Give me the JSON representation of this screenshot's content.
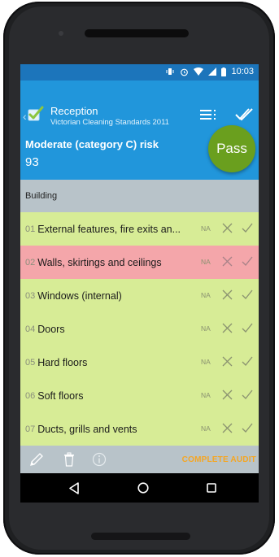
{
  "status_bar": {
    "time": "10:03"
  },
  "app_bar": {
    "title": "Reception",
    "subtitle": "Victorian Cleaning Standards 2011",
    "risk_label": "Moderate (category C) risk",
    "risk_score": "93",
    "result": "Pass"
  },
  "section": {
    "title": "Building"
  },
  "items": [
    {
      "num": "01",
      "label": "External features, fire exits an...",
      "na": "NA",
      "status": "ok"
    },
    {
      "num": "02",
      "label": "Walls, skirtings and ceilings",
      "na": "NA",
      "status": "fail"
    },
    {
      "num": "03",
      "label": "Windows (internal)",
      "na": "NA",
      "status": "ok"
    },
    {
      "num": "04",
      "label": "Doors",
      "na": "NA",
      "status": "ok"
    },
    {
      "num": "05",
      "label": "Hard floors",
      "na": "NA",
      "status": "ok"
    },
    {
      "num": "06",
      "label": "Soft floors",
      "na": "NA",
      "status": "ok"
    },
    {
      "num": "07",
      "label": "Ducts, grills and vents",
      "na": "NA",
      "status": "ok"
    }
  ],
  "toolbar": {
    "complete_label": "COMPLETE AUDIT"
  },
  "colors": {
    "primary": "#2196db",
    "status_bar": "#1c75bb",
    "pass": "#6a9f1e",
    "row_ok": "#d7ec96",
    "row_fail": "#f4a6aa",
    "accent": "#f5a623"
  },
  "icons": [
    "back-chevron-icon",
    "checklist-logo-icon",
    "menu-icon",
    "done-all-icon",
    "close-icon",
    "check-icon",
    "pencil-icon",
    "trash-icon",
    "info-icon",
    "nav-back-icon",
    "nav-home-icon",
    "nav-recents-icon"
  ]
}
